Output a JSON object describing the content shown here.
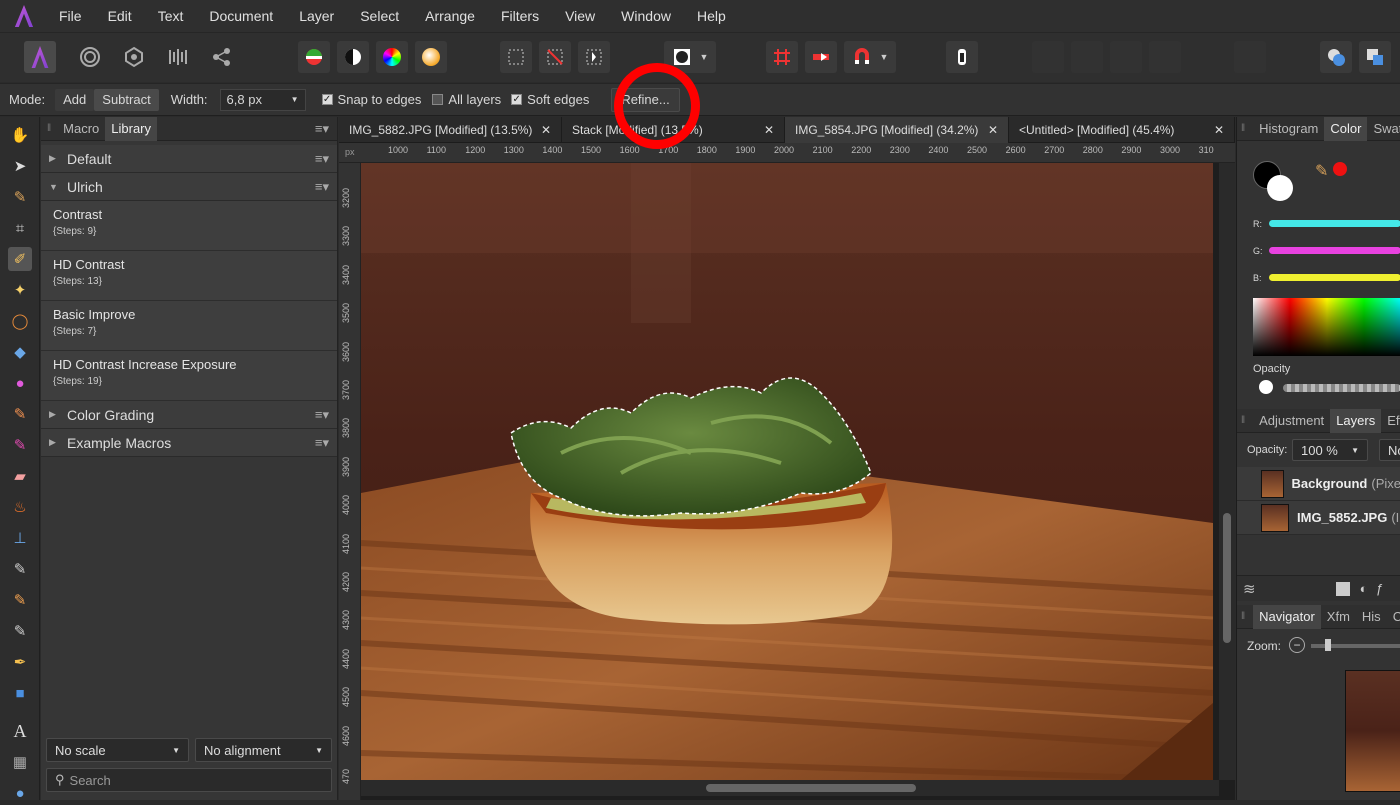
{
  "menu": [
    "File",
    "Edit",
    "Text",
    "Document",
    "Layer",
    "Select",
    "Arrange",
    "Filters",
    "View",
    "Window",
    "Help"
  ],
  "context": {
    "mode_label": "Mode:",
    "add": "Add",
    "subtract": "Subtract",
    "width_label": "Width:",
    "width_value": "6,8 px",
    "snap": "Snap to edges",
    "all_layers": "All layers",
    "soft_edges": "Soft edges",
    "refine": "Refine..."
  },
  "macro_panel": {
    "tabs": [
      "Macro",
      "Library"
    ],
    "categories": [
      {
        "label": "Default"
      },
      {
        "label": "Ulrich"
      }
    ],
    "macros": [
      {
        "name": "Contrast",
        "steps": "{Steps: 9}"
      },
      {
        "name": "HD Contrast",
        "steps": "{Steps: 13}"
      },
      {
        "name": "Basic Improve",
        "steps": "{Steps: 7}"
      },
      {
        "name": "HD Contrast Increase Exposure",
        "steps": "{Steps: 19}"
      }
    ],
    "more_categories": [
      {
        "label": "Color Grading"
      },
      {
        "label": "Example Macros"
      }
    ],
    "scale": "No scale",
    "alignment": "No alignment",
    "search_placeholder": "Search"
  },
  "doc_tabs": [
    {
      "label": "IMG_5882.JPG [Modified] (13.5%)"
    },
    {
      "label": "Stack [Modified] (13.5%)"
    },
    {
      "label": "IMG_5854.JPG [Modified] (34.2%)"
    },
    {
      "label": "<Untitled> [Modified] (45.4%)"
    }
  ],
  "ruler": {
    "unit": "px",
    "h": [
      "1000",
      "1100",
      "1200",
      "1300",
      "1400",
      "1500",
      "1600",
      "1700",
      "1800",
      "1900",
      "2000",
      "2100",
      "2200",
      "2300",
      "2400",
      "2500",
      "2600",
      "2700",
      "2800",
      "2900",
      "3000",
      "310"
    ],
    "v": [
      "3200",
      "3300",
      "3400",
      "3500",
      "3600",
      "3700",
      "3800",
      "3900",
      "4000",
      "4100",
      "4200",
      "4300",
      "4400",
      "4500",
      "4600",
      "470"
    ]
  },
  "right_panel": {
    "color_tabs": [
      "Histogram",
      "Color",
      "Swatc"
    ],
    "r": "R:",
    "g": "G:",
    "b": "B:",
    "opacity": "Opacity",
    "layer_tabs": [
      "Adjustment",
      "Layers",
      "Effe"
    ],
    "opacity_label": "Opacity:",
    "opacity_value": "100 %",
    "blend": "No",
    "layers": [
      {
        "name": "Background",
        "meta": "(Pixe"
      },
      {
        "name": "IMG_5852.JPG",
        "meta": "(I"
      }
    ],
    "nav_tabs": [
      "Navigator",
      "Xfm",
      "His",
      "Ch"
    ],
    "zoom_label": "Zoom:"
  },
  "colors": {
    "accent": "#ff0000",
    "selection": "#ffffff"
  }
}
